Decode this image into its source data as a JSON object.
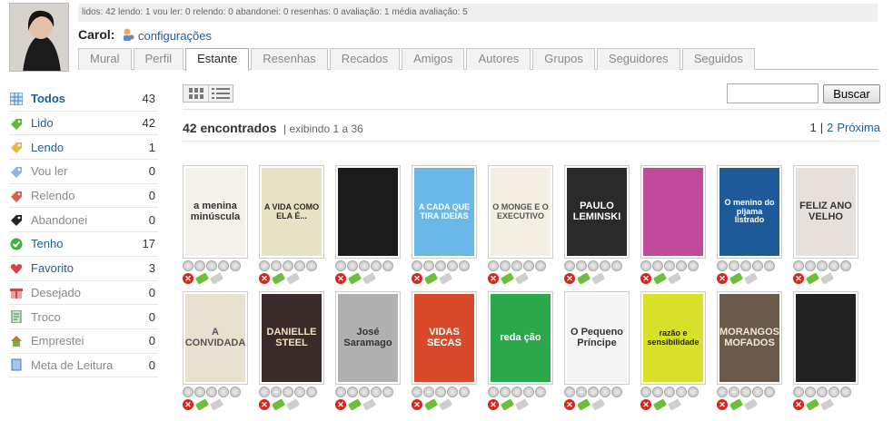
{
  "stats_line": "lidos: 42 lendo: 1 vou ler: 0 relendo: 0 abandonei: 0 resenhas: 0 avaliação: 1 média avaliação: 5",
  "user": {
    "name": "Carol:",
    "settings_label": "configurações"
  },
  "tabs": [
    "Mural",
    "Perfil",
    "Estante",
    "Resenhas",
    "Recados",
    "Amigos",
    "Autores",
    "Grupos",
    "Seguidores",
    "Seguidos"
  ],
  "active_tab": "Estante",
  "sidebar": [
    {
      "label": "Todos",
      "count": "43",
      "icon": "grid-icon",
      "color": "#3b7bd1"
    },
    {
      "label": "Lido",
      "count": "42",
      "icon": "tag-green-icon",
      "color": "#5cb82c"
    },
    {
      "label": "Lendo",
      "count": "1",
      "icon": "tag-yellow-icon",
      "color": "#e0b84a"
    },
    {
      "label": "Vou ler",
      "count": "0",
      "icon": "tag-blue-icon",
      "color": "#8fb6e0"
    },
    {
      "label": "Relendo",
      "count": "0",
      "icon": "tag-red-icon",
      "color": "#e05a4a"
    },
    {
      "label": "Abandonei",
      "count": "0",
      "icon": "tag-black-icon",
      "color": "#222222"
    },
    {
      "label": "Tenho",
      "count": "17",
      "icon": "check-icon",
      "color": "#3bb13b"
    },
    {
      "label": "Favorito",
      "count": "3",
      "icon": "heart-icon",
      "color": "#e0404a"
    },
    {
      "label": "Desejado",
      "count": "0",
      "icon": "gift-icon",
      "color": "#c05050"
    },
    {
      "label": "Troco",
      "count": "0",
      "icon": "exchange-icon",
      "color": "#3a8a3a"
    },
    {
      "label": "Emprestei",
      "count": "0",
      "icon": "house-icon",
      "color": "#d07030"
    },
    {
      "label": "Meta de Leitura",
      "count": "0",
      "icon": "book-icon",
      "color": "#3b7bd1"
    }
  ],
  "search": {
    "placeholder": "",
    "button": "Buscar"
  },
  "results": {
    "found": "42 encontrados",
    "showing": "| exibindo 1 a 36"
  },
  "pager": {
    "current": "1",
    "sep": "|",
    "next_page": "2",
    "next_label": "Próxima"
  },
  "books": [
    {
      "title": "a menina minúscula",
      "bg": "#f4f1ea",
      "fg": "#333333"
    },
    {
      "title": "A VIDA COMO ELA É...",
      "bg": "#e8e2c4",
      "fg": "#2a2a2a"
    },
    {
      "title": "",
      "bg": "#1a1a1a",
      "fg": "#cc2222"
    },
    {
      "title": "A CADA QUE TIRA IDEIAS",
      "bg": "#6ab8e8",
      "fg": "#ffffff"
    },
    {
      "title": "O MONGE E O EXECUTIVO",
      "bg": "#f3efe3",
      "fg": "#555555"
    },
    {
      "title": "PAULO LEMINSKI",
      "bg": "#2a2a2a",
      "fg": "#ffffff"
    },
    {
      "title": "",
      "bg": "#c04a9a",
      "fg": "#ffffff"
    },
    {
      "title": "O menino do pijama listrado",
      "bg": "#1e5a9a",
      "fg": "#ffffff"
    },
    {
      "title": "FELIZ ANO VELHO",
      "bg": "#e6e0dc",
      "fg": "#333333"
    },
    {
      "title": "A CONVIDADA",
      "bg": "#e9e1cf",
      "fg": "#555555"
    },
    {
      "title": "DANIELLE STEEL",
      "bg": "#3a2a2a",
      "fg": "#f0e0c0"
    },
    {
      "title": "José Saramago",
      "bg": "#b0b0b0",
      "fg": "#333333"
    },
    {
      "title": "VIDAS SECAS",
      "bg": "#d84a2a",
      "fg": "#ffffff"
    },
    {
      "title": "reda ção",
      "bg": "#2aa84a",
      "fg": "#ffffff"
    },
    {
      "title": "O Pequeno Príncipe",
      "bg": "#f5f5f5",
      "fg": "#333333"
    },
    {
      "title": "razão e sensibilidade",
      "bg": "#d8e02a",
      "fg": "#222222"
    },
    {
      "title": "MORANGOS MOFADOS",
      "bg": "#6a5a4a",
      "fg": "#f0e8d0"
    },
    {
      "title": "",
      "bg": "#222222",
      "fg": "#bbbbbb"
    }
  ]
}
